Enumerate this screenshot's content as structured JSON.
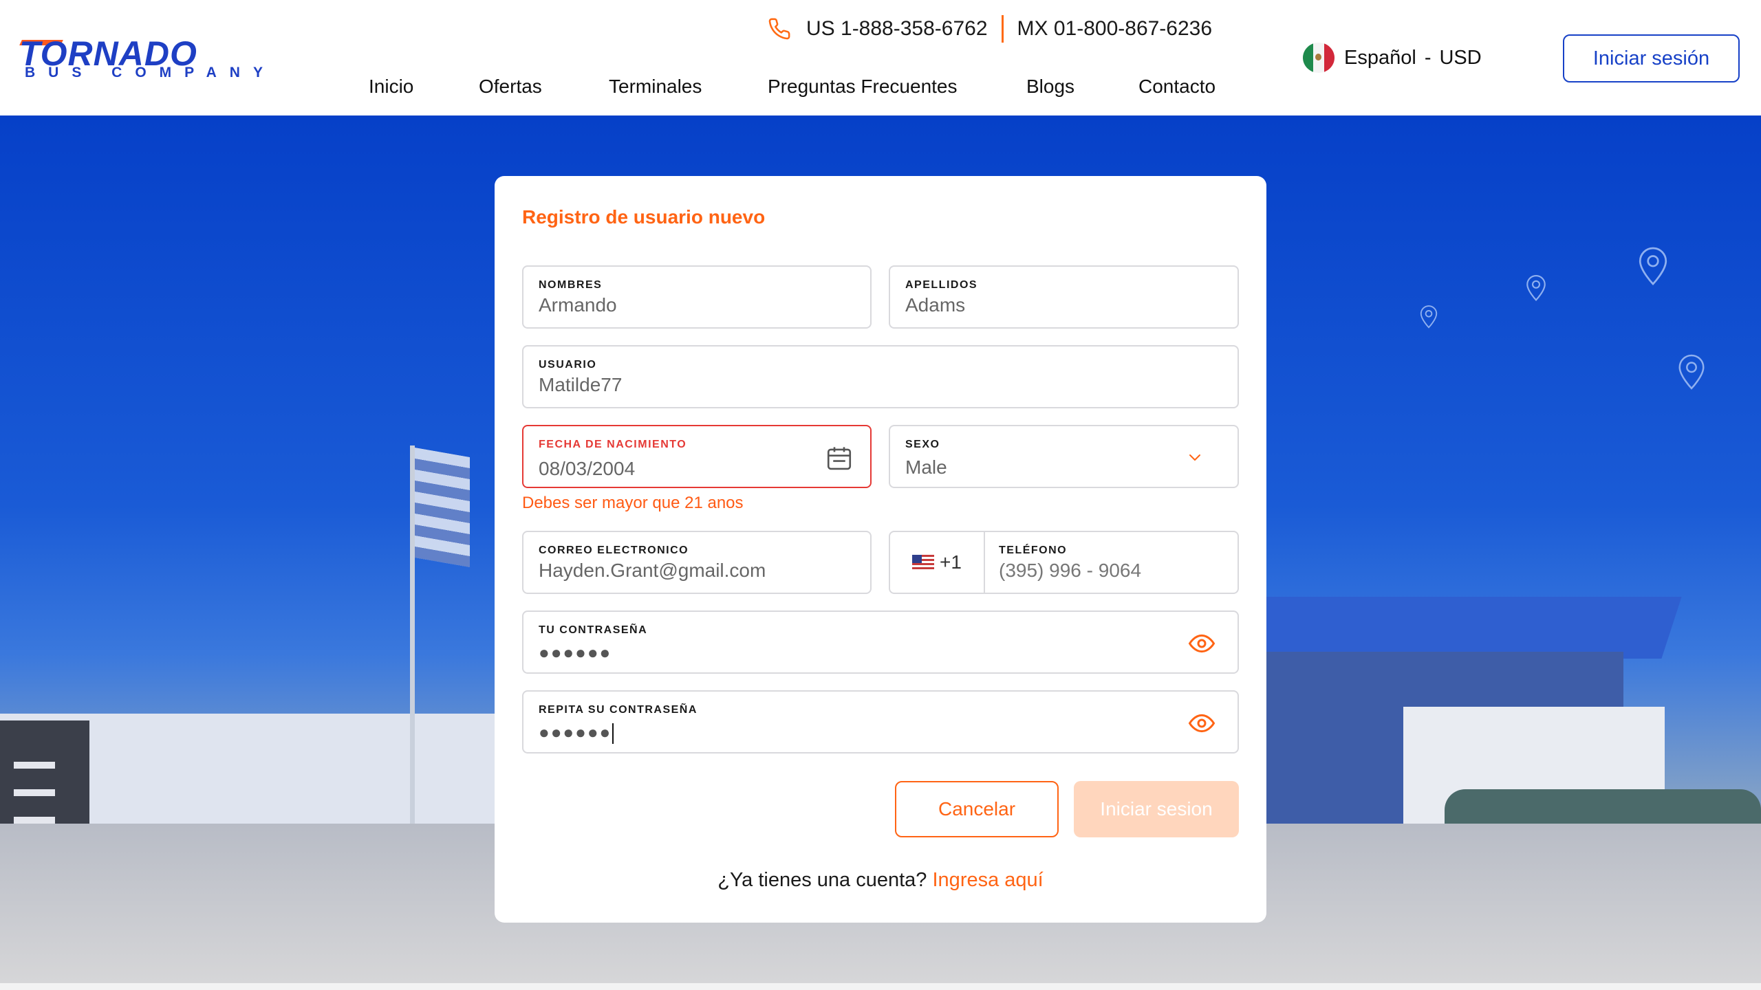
{
  "brand": {
    "name": "TORNADO",
    "tagline": "BUS COMPANY"
  },
  "header": {
    "phones": [
      "US 1-888-358-6762",
      "MX 01-800-867-6236"
    ],
    "language": "Español",
    "currency_sep": "-",
    "currency": "USD",
    "login_button": "Iniciar sesión"
  },
  "nav": {
    "items": [
      "Inicio",
      "Ofertas",
      "Terminales",
      "Preguntas Frecuentes",
      "Blogs",
      "Contacto"
    ]
  },
  "form": {
    "title": "Registro de usuario nuevo",
    "first_name": {
      "label": "NOMBRES",
      "value": "Armando"
    },
    "last_name": {
      "label": "APELLIDOS",
      "value": "Adams"
    },
    "username": {
      "label": "USUARIO",
      "value": "Matilde77"
    },
    "birth_date": {
      "label": "FECHA DE NACIMIENTO",
      "value": "08/03/2004",
      "error": "Debes ser mayor que 21 anos"
    },
    "sex": {
      "label": "SEXO",
      "value": "Male"
    },
    "email": {
      "label": "CORREO ELECTRONICO",
      "value": "Hayden.Grant@gmail.com"
    },
    "phone": {
      "label": "TELÉFONO",
      "country_code": "+1",
      "value": "(395) 996 - 9064"
    },
    "password": {
      "label": "TU CONTRASEÑA",
      "value": "●●●●●●"
    },
    "repeat_password": {
      "label": "REPITA SU CONTRASEÑA",
      "value": "●●●●●●"
    },
    "cancel_button": "Cancelar",
    "submit_button": "Iniciar sesion",
    "footer_prompt": "¿Ya tienes una cuenta?",
    "footer_link": "Ingresa aquí"
  },
  "colors": {
    "accent": "#ff6414",
    "brand_blue": "#1741c7",
    "hero_blue": "#0640c8",
    "error": "#e53935",
    "submit_disabled": "#ffd6bd"
  },
  "icons": [
    "phone-icon",
    "mexico-flag-icon",
    "calendar-icon",
    "chevron-down-icon",
    "us-flag-icon",
    "eye-icon",
    "location-pin-icon"
  ]
}
